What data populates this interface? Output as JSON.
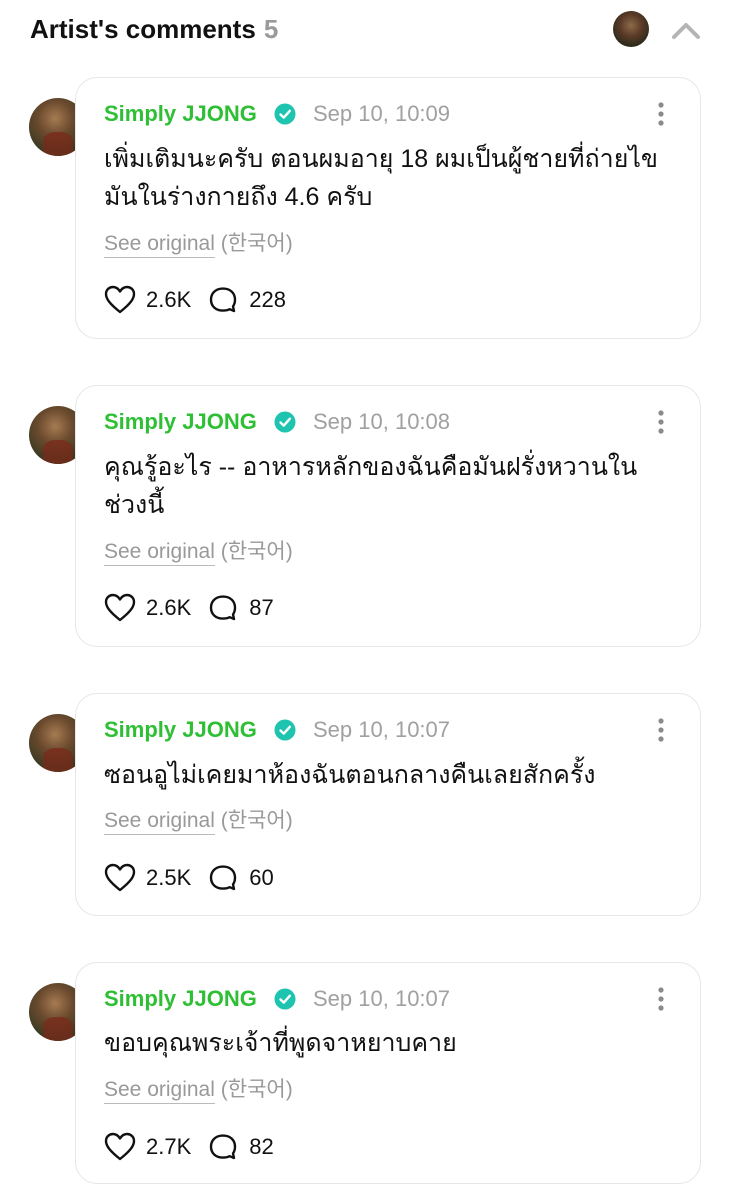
{
  "header": {
    "title": "Artist's comments",
    "count": "5"
  },
  "comments": [
    {
      "author": "Simply JJONG",
      "time": "Sep 10, 10:09",
      "text": "เพิ่มเติมนะครับ ตอนผมอายุ 18 ผมเป็นผู้ชายที่ถ่ายไขมันในร่างกายถึง 4.6 ครับ",
      "see_original": "See original",
      "language": "(한국어)",
      "likes": "2.6K",
      "replies": "228"
    },
    {
      "author": "Simply JJONG",
      "time": "Sep 10, 10:08",
      "text": "คุณรู้อะไร -- อาหารหลักของฉันคือมันฝรั่งหวานในช่วงนี้",
      "see_original": "See original",
      "language": "(한국어)",
      "likes": "2.6K",
      "replies": "87"
    },
    {
      "author": "Simply JJONG",
      "time": "Sep 10, 10:07",
      "text": "ซอนอูไม่เคยมาห้องฉันตอนกลางคืนเลยสักครั้ง",
      "see_original": "See original",
      "language": "(한국어)",
      "likes": "2.5K",
      "replies": "60"
    },
    {
      "author": "Simply JJONG",
      "time": "Sep 10, 10:07",
      "text": "ขอบคุณพระเจ้าที่พูดจาหยาบคาย",
      "see_original": "See original",
      "language": "(한국어)",
      "likes": "2.7K",
      "replies": "82"
    }
  ],
  "colors": {
    "author": "#2fbf35",
    "verified_badge": "#1fc4b0",
    "muted": "#a0a0a0"
  },
  "icons": {
    "verified": "verified-badge-icon",
    "more": "more-vertical-icon",
    "like": "heart-icon",
    "reply": "speech-bubble-icon",
    "collapse": "chevron-up-icon"
  }
}
